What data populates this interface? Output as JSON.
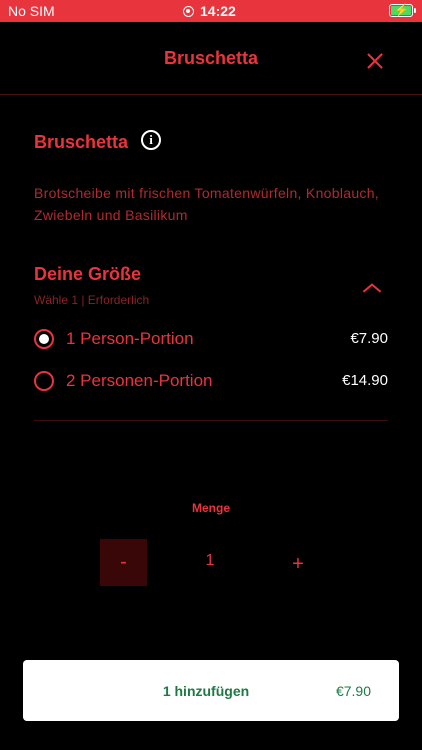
{
  "status_bar": {
    "carrier": "No SIM",
    "time": "14:22"
  },
  "header": {
    "title": "Bruschetta",
    "close_icon": "close-icon"
  },
  "product": {
    "name": "Bruschetta",
    "description": "Brotscheibe mit frischen Tomatenwürfeln, Knoblauch, Zwiebeln und Basilikum"
  },
  "size_group": {
    "title": "Deine Größe",
    "subtitle": "Wähle 1  |  Erforderlich",
    "options": [
      {
        "label": "1 Person-Portion",
        "price": "€7.90",
        "selected": true
      },
      {
        "label": "2 Personen-Portion",
        "price": "€14.90",
        "selected": false
      }
    ]
  },
  "quantity": {
    "label": "Menge",
    "value": "1",
    "minus": "-",
    "plus": "+"
  },
  "add_button": {
    "label": "1 hinzufügen",
    "price": "€7.90"
  },
  "colors": {
    "accent": "#e8343d",
    "background": "#000000",
    "add_text": "#1e7a45",
    "battery": "#4cd964"
  }
}
